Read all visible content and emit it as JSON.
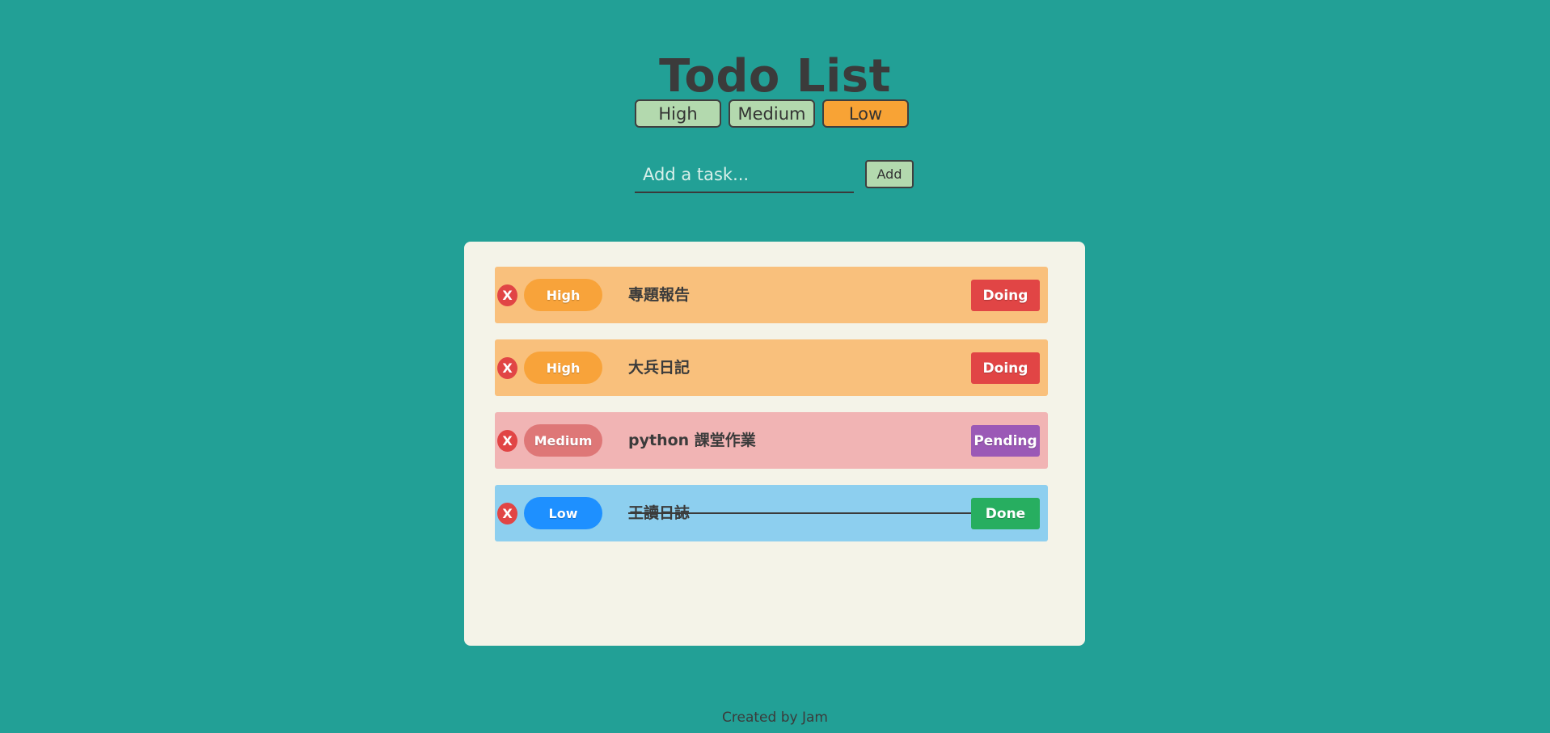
{
  "app": {
    "title": "Todo List",
    "footer": "Created by Jam"
  },
  "filters": [
    {
      "label": "High",
      "active": false
    },
    {
      "label": "Medium",
      "active": false
    },
    {
      "label": "Low",
      "active": true
    }
  ],
  "add_form": {
    "placeholder": "Add a task...",
    "value": "",
    "button_label": "Add"
  },
  "tasks": [
    {
      "delete_label": "X",
      "priority": "High",
      "text": "專題報告",
      "status": "Doing",
      "struck": false
    },
    {
      "delete_label": "X",
      "priority": "High",
      "text": "大兵日記",
      "status": "Doing",
      "struck": false
    },
    {
      "delete_label": "X",
      "priority": "Medium",
      "text": "python 課堂作業",
      "status": "Pending",
      "struck": false
    },
    {
      "delete_label": "X",
      "priority": "Low",
      "text": "王讀日誌",
      "status": "Done",
      "struck": true
    }
  ],
  "colors": {
    "background": "#22a096",
    "panel": "#f4f3e8",
    "row_high": "#f9c07c",
    "row_medium": "#f1b4b4",
    "row_low": "#8dcfef",
    "pill_high": "#f8a33a",
    "pill_medium": "#de7777",
    "pill_low": "#1e90ff",
    "status_doing": "#e14545",
    "status_pending": "#9b59b6",
    "status_done": "#27ae60",
    "filter_active": "#f8a335",
    "filter_inactive": "#b3d9ae"
  }
}
